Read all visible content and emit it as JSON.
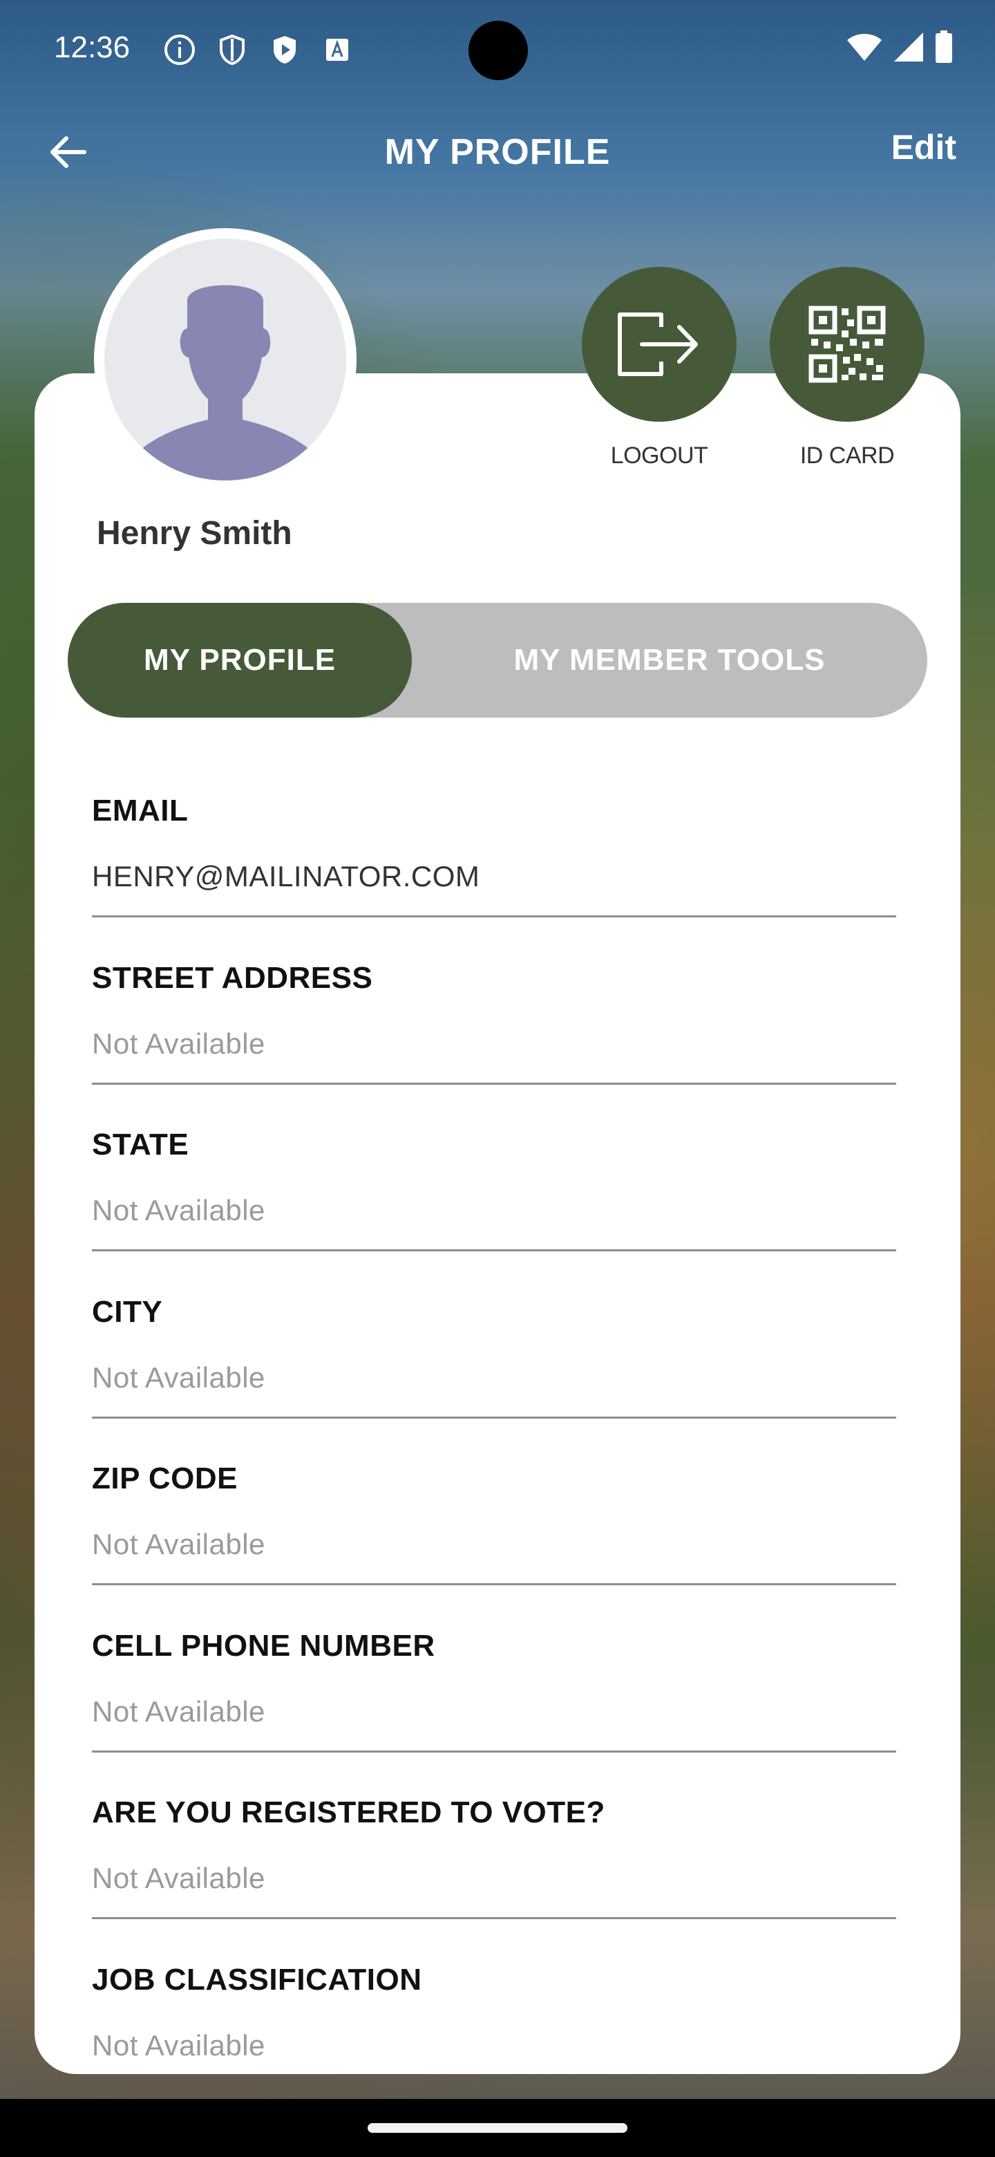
{
  "status_bar": {
    "time": "12:36",
    "left_icons": [
      "info-icon",
      "shield-icon",
      "play-shield-icon",
      "font-a-icon"
    ],
    "right_icons": [
      "wifi-icon",
      "signal-icon",
      "battery-icon"
    ]
  },
  "header": {
    "title": "MY PROFILE",
    "edit_label": "Edit",
    "back_icon": "arrow-left-icon"
  },
  "profile": {
    "name": "Henry Smith",
    "avatar_icon": "person-silhouette-icon"
  },
  "actions": [
    {
      "label": "LOGOUT",
      "icon": "logout-icon"
    },
    {
      "label": "ID CARD",
      "icon": "qr-code-icon"
    }
  ],
  "tabs": {
    "active": "MY PROFILE",
    "inactive": "MY MEMBER TOOLS"
  },
  "fields": [
    {
      "label": "EMAIL",
      "value": "HENRY@MAILINATOR.COM"
    },
    {
      "label": "STREET ADDRESS",
      "value": "Not Available"
    },
    {
      "label": "STATE",
      "value": "Not Available"
    },
    {
      "label": "CITY",
      "value": "Not Available"
    },
    {
      "label": "ZIP CODE",
      "value": "Not Available"
    },
    {
      "label": "CELL PHONE NUMBER",
      "value": "Not Available"
    },
    {
      "label": "ARE YOU REGISTERED TO VOTE?",
      "value": "Not Available"
    },
    {
      "label": "JOB CLASSIFICATION",
      "value": "Not Available"
    }
  ],
  "colors": {
    "accent": "#465a39",
    "tab_inactive": "#bdbdbd",
    "card": "#ffffff"
  }
}
